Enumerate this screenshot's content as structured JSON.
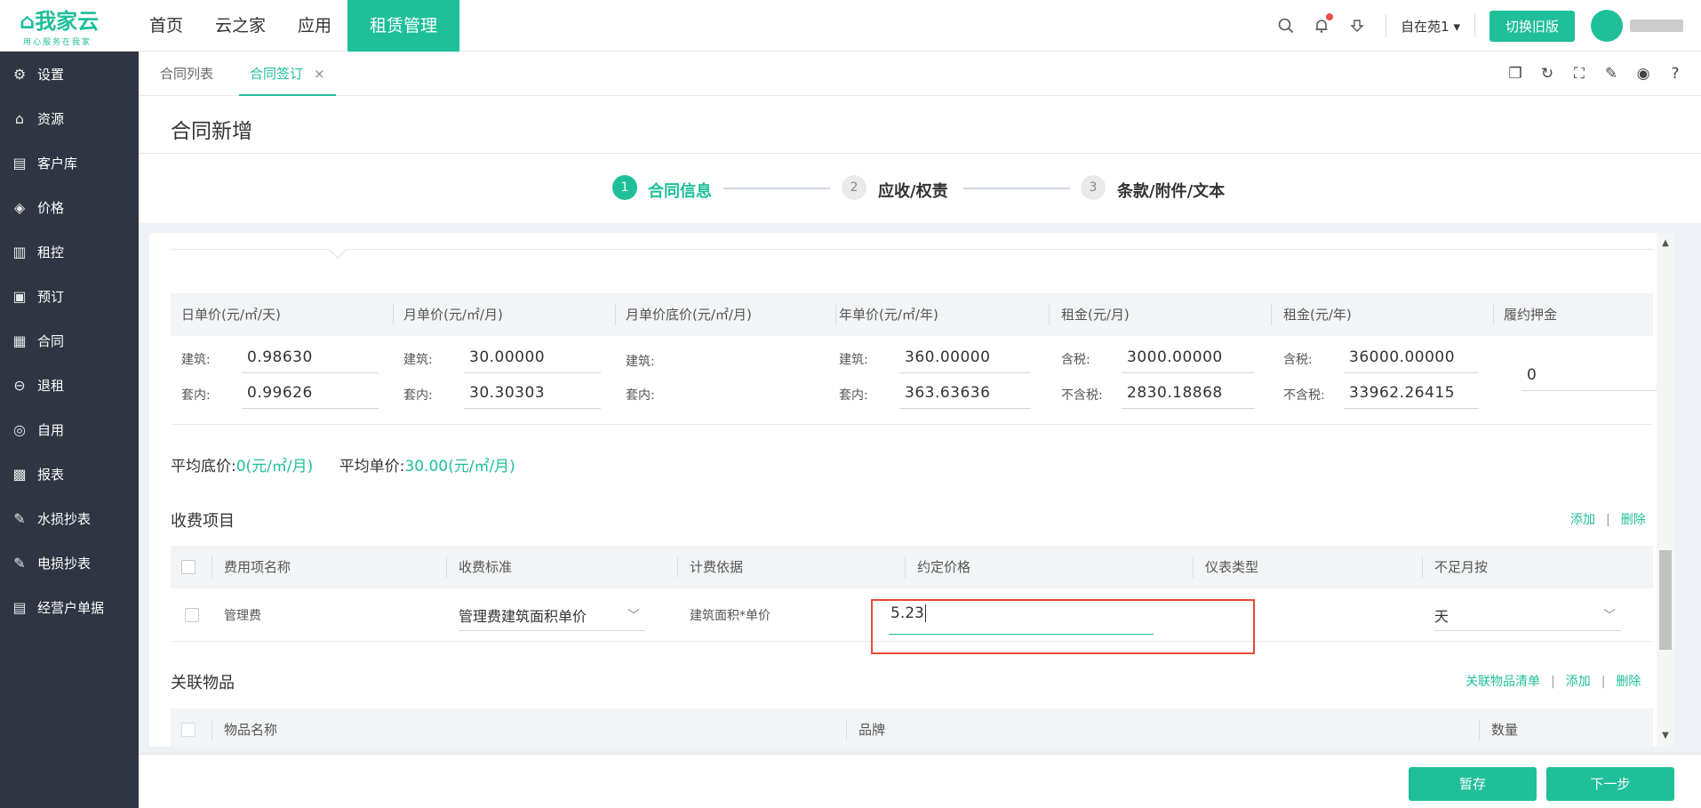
{
  "logo": {
    "name": "我家云",
    "slogan": "用心服务在我家"
  },
  "top_nav": [
    "首页",
    "云之家",
    "应用",
    "租赁管理"
  ],
  "header": {
    "user_select": "自在苑1 ▾",
    "switch_label": "切换旧版"
  },
  "sidebar": {
    "items": [
      "设置",
      "资源",
      "客户库",
      "价格",
      "租控",
      "预订",
      "合同",
      "退租",
      "自用",
      "报表",
      "水损抄表",
      "电损抄表",
      "经营户单据"
    ]
  },
  "tabs": {
    "list_label": "合同列表",
    "active_label": "合同签订",
    "close": "×"
  },
  "page": {
    "title": "合同新增"
  },
  "steps": [
    {
      "num": "1",
      "label": "合同信息"
    },
    {
      "num": "2",
      "label": "应收/权责"
    },
    {
      "num": "3",
      "label": "条款/附件/文本"
    }
  ],
  "price_table": {
    "headers": [
      "日单价(元/㎡/天)",
      "月单价(元/㎡/月)",
      "月单价底价(元/㎡/月)",
      "年单价(元/㎡/年)",
      "租金(元/月)",
      "租金(元/年)",
      "履约押金"
    ],
    "build_label": "建筑:",
    "inner_label": "套内:",
    "tax_label": "含税:",
    "notax_label": "不含税:",
    "day_build": "0.98630",
    "day_inner": "0.99626",
    "month_build": "30.00000",
    "month_inner": "30.30303",
    "year_build": "360.00000",
    "year_inner": "363.63636",
    "rent_month_tax": "3000.00000",
    "rent_month_notax": "2830.18868",
    "rent_year_tax": "36000.00000",
    "rent_year_notax": "33962.26415",
    "deposit": "0"
  },
  "avg": {
    "floor_label": "平均底价:",
    "floor_value": "0(元/㎡/月)",
    "unit_label": "平均单价:",
    "unit_value": "30.00(元/㎡/月)"
  },
  "fees": {
    "title": "收费项目",
    "add": "添加",
    "delete": "删除",
    "sep": "|",
    "headers": [
      "费用项名称",
      "收费标准",
      "计费依据",
      "约定价格",
      "仪表类型",
      "不足月按"
    ],
    "row": {
      "name": "管理费",
      "standard": "管理费建筑面积单价",
      "basis": "建筑面积*单价",
      "price": "5.23",
      "meter": "",
      "partial": "天"
    }
  },
  "items": {
    "title": "关联物品",
    "list_link": "关联物品清单",
    "add": "添加",
    "delete": "删除",
    "headers": [
      "物品名称",
      "品牌",
      "数量"
    ]
  },
  "footer": {
    "save": "暂存",
    "next": "下一步"
  },
  "colors": {
    "accent": "#1fbf9a",
    "sidebar": "#2f3542",
    "highlight": "#e84b3c"
  }
}
